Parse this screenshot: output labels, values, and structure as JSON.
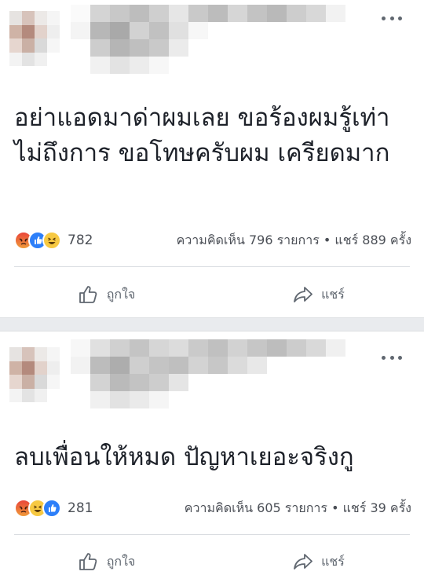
{
  "posts": [
    {
      "text": "อย่าแอดมาด่าผมเลย ขอร้องผมรู้เท่าไม่ถึงการ ขอโทษครับผม เครียดมาก",
      "reaction_count": "782",
      "comments_shares": "ความคิดเห็น 796 รายการ • แชร์ 889 ครั้ง",
      "reactions": [
        "angry",
        "like",
        "haha"
      ],
      "like_label": "ถูกใจ",
      "share_label": "แชร์"
    },
    {
      "text": "ลบเพื่อนให้หมด ปัญหาเยอะจริงกู",
      "reaction_count": "281",
      "comments_shares": "ความคิดเห็น 605 รายการ • แชร์ 39 ครั้ง",
      "reactions": [
        "angry",
        "haha",
        "like"
      ],
      "like_label": "ถูกใจ",
      "share_label": "แชร์"
    }
  ],
  "icons": {
    "more": "more-options-icon",
    "like": "thumbs-up-icon",
    "share": "share-arrow-icon"
  },
  "colors": {
    "text": "#1d2129",
    "secondary": "#606770",
    "like_blue": "#2d7ff9",
    "separator": "#e9ebee"
  }
}
